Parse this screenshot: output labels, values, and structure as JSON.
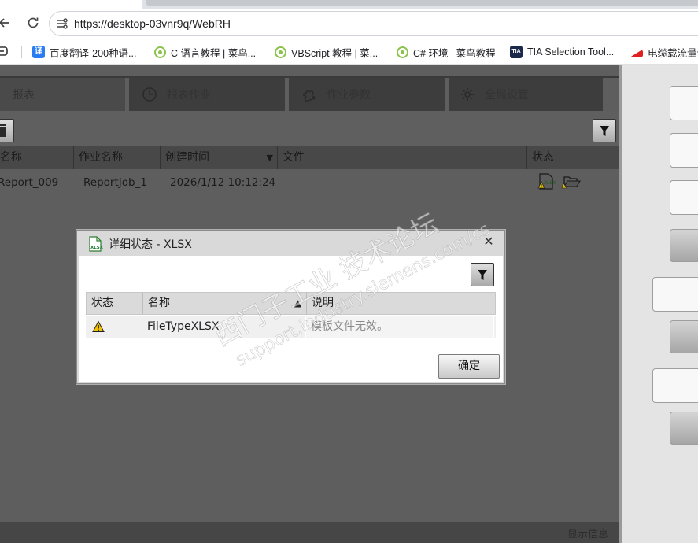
{
  "browser": {
    "url": "https://desktop-03vnr9q/WebRH",
    "bookmarks": [
      {
        "label": "百度翻译-200种语...",
        "icon": "baidu-translate-icon"
      },
      {
        "label": "C 语言教程 | 菜鸟...",
        "icon": "runoob-icon"
      },
      {
        "label": "VBScript 教程 | 菜...",
        "icon": "runoob-icon"
      },
      {
        "label": "C# 环境 | 菜鸟教程",
        "icon": "runoob-icon"
      },
      {
        "label": "TIA Selection Tool...",
        "icon": "tia-icon"
      },
      {
        "label": "电缆载流量计",
        "icon": "cable-icon"
      }
    ]
  },
  "app": {
    "tabs": [
      {
        "label": "报表",
        "icon": ""
      },
      {
        "label": "报表作业",
        "icon": "clock-icon"
      },
      {
        "label": "作业参数",
        "icon": "puzzle-icon"
      },
      {
        "label": "全局设置",
        "icon": "gear-icon"
      }
    ],
    "table": {
      "columns": [
        "名称",
        "作业名称",
        "创建时间",
        "文件",
        "状态"
      ],
      "rows": [
        {
          "name": "Report_009",
          "job": "ReportJob_1",
          "created": "2026/1/12 10:12:24",
          "file": "",
          "status_icons": [
            "xlsx-warning-icon",
            "folder-icon"
          ]
        }
      ]
    },
    "status_bar": "显示信息"
  },
  "dialog": {
    "title": "详细状态 - XLSX",
    "columns": [
      "状态",
      "名称",
      "说明"
    ],
    "rows": [
      {
        "status_icon": "warning-icon",
        "name": "FileTypeXLSX",
        "description": "模板文件无效。"
      }
    ],
    "ok_label": "确定"
  },
  "watermark": {
    "line1": "西门子工业  技术论坛",
    "line2": "support.industry.siemens.com/cs"
  },
  "colors": {
    "app_bg": "#5e5e5e",
    "warning": "#f2c200",
    "xlsx_green": "#1d7a33"
  }
}
